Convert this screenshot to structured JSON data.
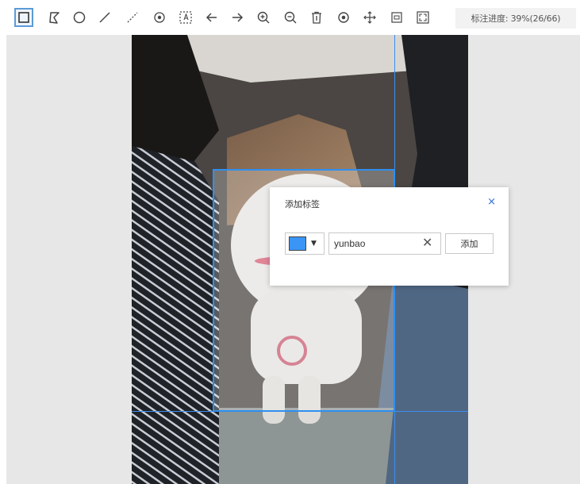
{
  "toolbar": {
    "tools": [
      {
        "name": "rectangle-tool-icon"
      },
      {
        "name": "polygon-tool-icon"
      },
      {
        "name": "circle-tool-icon"
      },
      {
        "name": "line-tool-icon"
      },
      {
        "name": "polyline-tool-icon"
      },
      {
        "name": "point-tool-icon"
      },
      {
        "name": "text-box-tool-icon"
      },
      {
        "name": "undo-icon"
      },
      {
        "name": "redo-icon"
      },
      {
        "name": "zoom-in-icon"
      },
      {
        "name": "zoom-out-icon"
      },
      {
        "name": "delete-icon"
      },
      {
        "name": "view-icon"
      },
      {
        "name": "move-icon"
      },
      {
        "name": "fit-icon"
      },
      {
        "name": "fullscreen-icon"
      }
    ],
    "active_tool": "rectangle-tool-icon",
    "progress_text": "标注进度: 39%(26/66)"
  },
  "dialog": {
    "title": "添加标签",
    "close_glyph": "×",
    "label_value": "yunbao",
    "clear_glyph": "✕",
    "caret_glyph": "▼",
    "add_label": "添加",
    "swatch_color": "#3a95f6"
  },
  "colors": {
    "accent": "#2f8ff0",
    "guide": "#3b8ff0"
  }
}
